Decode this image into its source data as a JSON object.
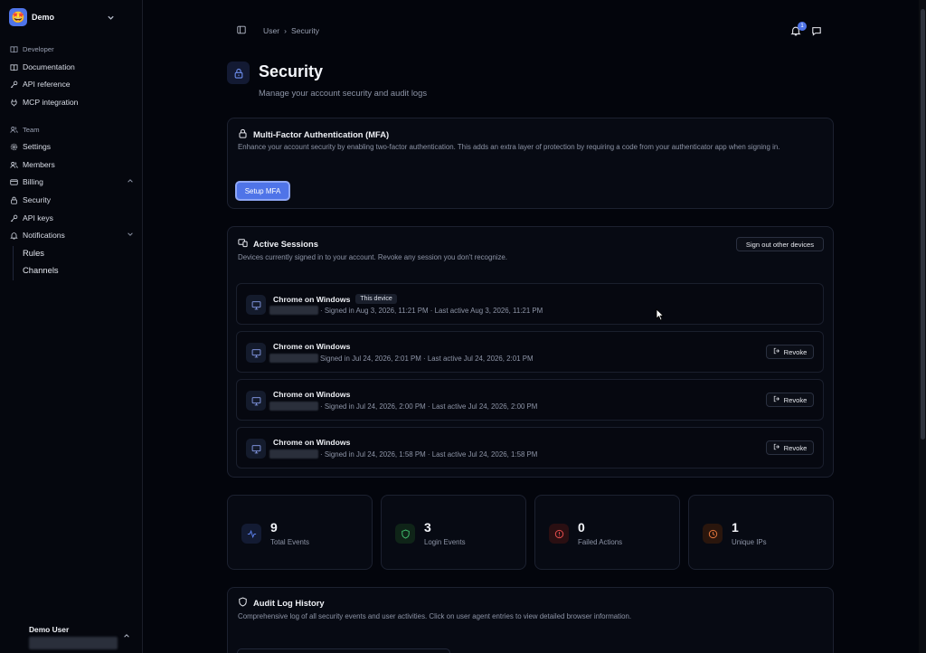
{
  "workspace": {
    "name": "Demo",
    "logo": "🤩"
  },
  "sidebar": {
    "sections": [
      {
        "label": "Developer",
        "icon": "book-icon"
      },
      {
        "label": "Team",
        "icon": "users-icon"
      }
    ],
    "developer_items": [
      {
        "label": "Documentation",
        "icon": "book-open-icon"
      },
      {
        "label": "API reference",
        "icon": "key-icon"
      },
      {
        "label": "MCP integration",
        "icon": "plug-icon"
      }
    ],
    "team_items": [
      {
        "label": "Settings",
        "icon": "gear-icon"
      },
      {
        "label": "Members",
        "icon": "users-icon"
      },
      {
        "label": "Billing",
        "icon": "card-icon",
        "expanded": true
      },
      {
        "label": "Security",
        "icon": "lock-icon"
      },
      {
        "label": "API keys",
        "icon": "key-icon"
      },
      {
        "label": "Notifications",
        "icon": "bell-icon",
        "expanded": true
      }
    ],
    "notification_sub": [
      "Rules",
      "Channels"
    ],
    "user": {
      "name": "Demo User"
    }
  },
  "topbar": {
    "breadcrumb": [
      "User",
      "Security"
    ],
    "notification_count": "1"
  },
  "page": {
    "title": "Security",
    "subtitle": "Manage your account security and audit logs"
  },
  "mfa": {
    "title": "Multi-Factor Authentication (MFA)",
    "description": "Enhance your account security by enabling two-factor authentication. This adds an extra layer of protection by requiring a code from your authenticator app when signing in.",
    "button": "Setup MFA"
  },
  "sessions": {
    "title": "Active Sessions",
    "description": "Devices currently signed in to your account. Revoke any session you don't recognize.",
    "sign_out_others": "Sign out other devices",
    "items": [
      {
        "device": "Chrome on Windows",
        "tag": "This device",
        "meta": "· Signed in Aug 3, 2026, 11:21 PM · Last active Aug 3, 2026, 11:21 PM",
        "revoke": ""
      },
      {
        "device": "Chrome on Windows",
        "tag": "",
        "meta": "Signed in Jul 24, 2026, 2:01 PM · Last active Jul 24, 2026, 2:01 PM",
        "revoke": "Revoke"
      },
      {
        "device": "Chrome on Windows",
        "tag": "",
        "meta": "· Signed in Jul 24, 2026, 2:00 PM · Last active Jul 24, 2026, 2:00 PM",
        "revoke": "Revoke"
      },
      {
        "device": "Chrome on Windows",
        "tag": "",
        "meta": "· Signed in Jul 24, 2026, 1:58 PM · Last active Jul 24, 2026, 1:58 PM",
        "revoke": "Revoke"
      }
    ]
  },
  "stats": [
    {
      "value": "9",
      "label": "Total Events",
      "icon": "activity-icon",
      "color": "#5a7ee9",
      "bg": "#131b33"
    },
    {
      "value": "3",
      "label": "Login Events",
      "icon": "shield-check-icon",
      "color": "#3fb96b",
      "bg": "#0f2418"
    },
    {
      "value": "0",
      "label": "Failed Actions",
      "icon": "alert-circle-icon",
      "color": "#e24c4c",
      "bg": "#2a0f12"
    },
    {
      "value": "1",
      "label": "Unique IPs",
      "icon": "clock-icon",
      "color": "#e0733a",
      "bg": "#2a160d"
    }
  ],
  "audit": {
    "title": "Audit Log History",
    "description": "Comprehensive log of all security events and user activities. Click on user agent entries to view detailed browser information."
  },
  "colors": {
    "accent": "#4f74e8",
    "background": "#03050c"
  }
}
